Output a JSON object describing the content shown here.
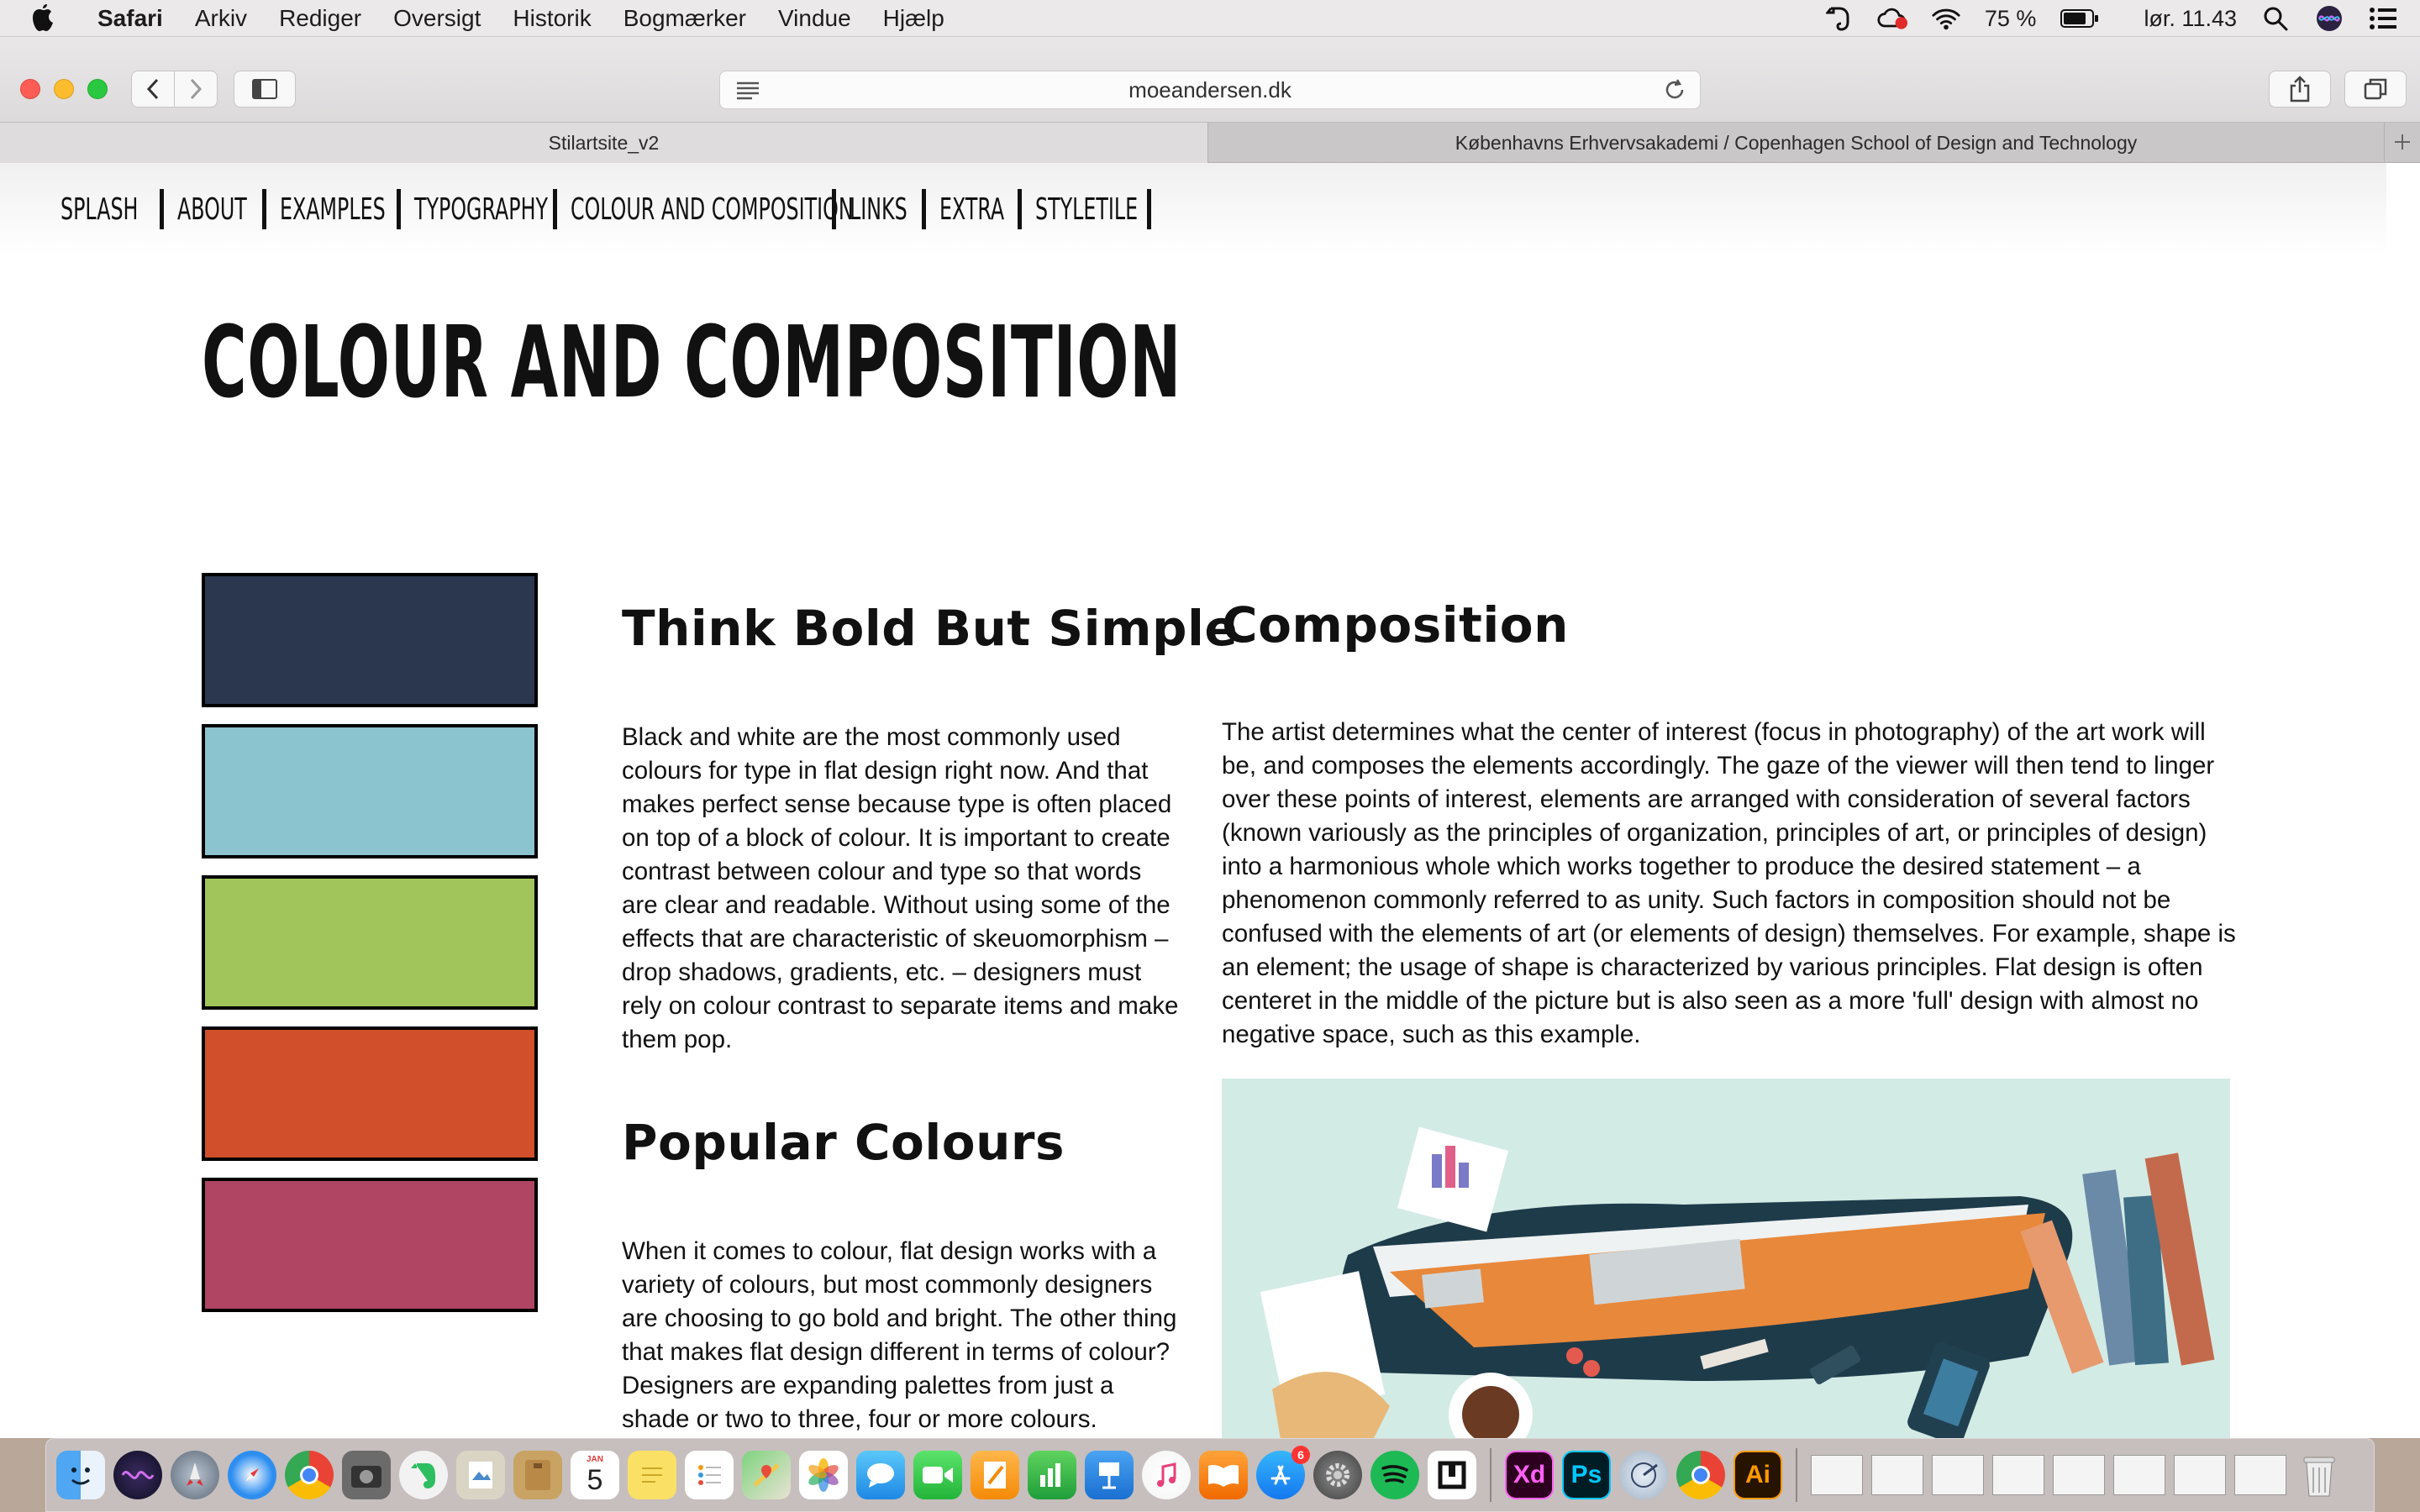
{
  "menubar": {
    "app": "Safari",
    "items": [
      "Arkiv",
      "Rediger",
      "Oversigt",
      "Historik",
      "Bogmærker",
      "Vindue",
      "Hjælp"
    ],
    "battery": "75 %",
    "clock": "lør. 11.43"
  },
  "browser": {
    "url": "moeandersen.dk",
    "tabs": [
      "Stilartsite_v2",
      "Københavns Erhvervsakademi / Copenhagen School of Design and Technology"
    ]
  },
  "site": {
    "nav": [
      "SPLASH",
      "ABOUT",
      "EXAMPLES",
      "TYPOGRAPHY",
      "COLOUR AND COMPOSITION",
      "LINKS",
      "EXTRA",
      "STYLETILE"
    ],
    "title": "COLOUR AND COMPOSITION",
    "swatches": [
      "#2b374f",
      "#8bc3cf",
      "#a1c55a",
      "#d14f2a",
      "#b04463"
    ],
    "sections": {
      "bold": {
        "heading": "Think Bold But Simple",
        "text": "Black and white are the most commonly used colours for type in flat design right now. And that makes perfect sense because type is often placed on top of a block of colour. It is important to create contrast between colour and type so that words are clear and readable. Without using some of the effects that are characteristic of skeuomorphism – drop shadows, gradients, etc. – designers must rely on colour contrast to separate items and make them pop."
      },
      "popular": {
        "heading": "Popular Colours",
        "text": "When it comes to colour, flat design works with a variety of colours, but most commonly designers are choosing to go bold and bright. The other thing that makes flat design different in terms of colour? Designers are expanding palettes from just a shade or two to three, four or more colours."
      },
      "composition": {
        "heading": "Composition",
        "text": "The artist determines what the center of interest (focus in photography) of the art work will be, and composes the elements accordingly. The gaze of the viewer will then tend to linger over these points of interest, elements are arranged with consideration of several factors (known variously as the principles of organization, principles of art, or principles of design) into a harmonious whole which works together to produce the desired statement – a phenomenon commonly referred to as unity. Such factors in composition should not be confused with the elements of art (or elements of design) themselves. For example, shape is an element; the usage of shape is characterized by various principles. Flat design is often centeret in the middle of the picture but is also seen as a more 'full' design with almost no negative space, such as this example."
      }
    }
  },
  "dock": {
    "calendar_day": "5",
    "calendar_month": "JAN",
    "appstore_badge": "6",
    "xd_label": "Xd",
    "ps_label": "Ps",
    "ai_label": "Ai"
  }
}
